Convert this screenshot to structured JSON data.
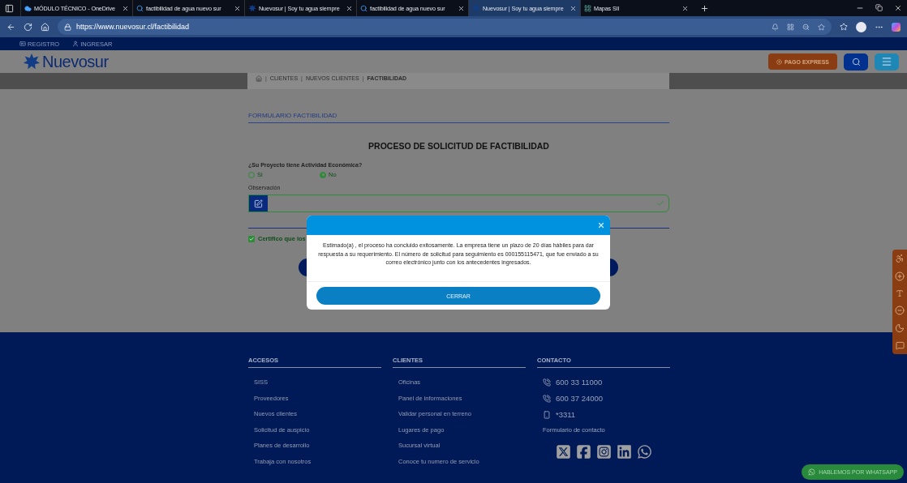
{
  "browser": {
    "tabs": [
      {
        "kind": "cloud",
        "title": "MÓDULO TÉCNICO - OneDrive",
        "selected": false
      },
      {
        "kind": "search",
        "title": "factibilidad de agua nuevo sur",
        "selected": false
      },
      {
        "kind": "logo",
        "title": "Nuevosur | Soy tu agua siempre",
        "selected": false
      },
      {
        "kind": "search",
        "title": "factibilidad de agua nuevo sur",
        "selected": false
      },
      {
        "kind": "logo",
        "title": "Nuevosur | Soy tu agua siempre",
        "selected": true
      },
      {
        "kind": "map",
        "title": "Mapas SII",
        "selected": false
      }
    ],
    "url": "https://www.nuevosur.cl/factibilidad"
  },
  "site": {
    "top_links": [
      {
        "kind": "card",
        "label": "REGISTRO"
      },
      {
        "kind": "user",
        "label": "INGRESAR"
      }
    ],
    "logo": "Nuevosur",
    "pay_button": "PAGO EXPRESS",
    "breadcrumb_separator": "|",
    "breadcrumb": [
      "CLIENTES",
      "NUEVOS CLIENTES",
      "FACTIBILIDAD"
    ]
  },
  "form": {
    "section_title": "FORMULARIO FACTIBILIDAD",
    "heading": "PROCESO DE SOLICITUD DE FACTIBILIDAD",
    "question": "¿Su Proyecto tiene Actividad Económica?",
    "options": [
      {
        "label": "Si",
        "selected": false
      },
      {
        "label": "No",
        "selected": true
      }
    ],
    "observation_label": "Observación",
    "certify": {
      "label": "Certifico que los",
      "checked": true
    }
  },
  "dialog": {
    "message": "Estimado(a) , el proceso ha concluido exitosamente. La empresa tiene un plazo de 20 días hábiles para dar respuesta a su requerimiento. El número de solicitud para seguimiento es 000155115471, que fue enviado a su correo electrónico junto con los antecedentes ingresados.",
    "button": "CERRAR"
  },
  "footer": {
    "columns": [
      {
        "title": "ACCESOS",
        "links": [
          "SISS",
          "Proveedores",
          "Nuevos clientes",
          "Solicitud de auspicio",
          "Planes de desarrollo",
          "Trabaja con nosotros"
        ]
      },
      {
        "title": "CLIENTES",
        "links": [
          "Oficinas",
          "Panel de informaciones",
          "Validar personal en terreno",
          "Lugares de pago",
          "Sucursal virtual",
          "Conoce tu numero de servicio"
        ]
      }
    ],
    "contact": {
      "title": "CONTACTO",
      "items": [
        {
          "kind": "phone",
          "text": "600 33 11000"
        },
        {
          "kind": "phone",
          "text": "600 37 24000"
        },
        {
          "kind": "mobile",
          "text": "*3311"
        },
        {
          "kind": "link",
          "text": "Formulario de contacto"
        }
      ]
    }
  },
  "whatsapp": "HABLEMOS POR WHATSAPP"
}
